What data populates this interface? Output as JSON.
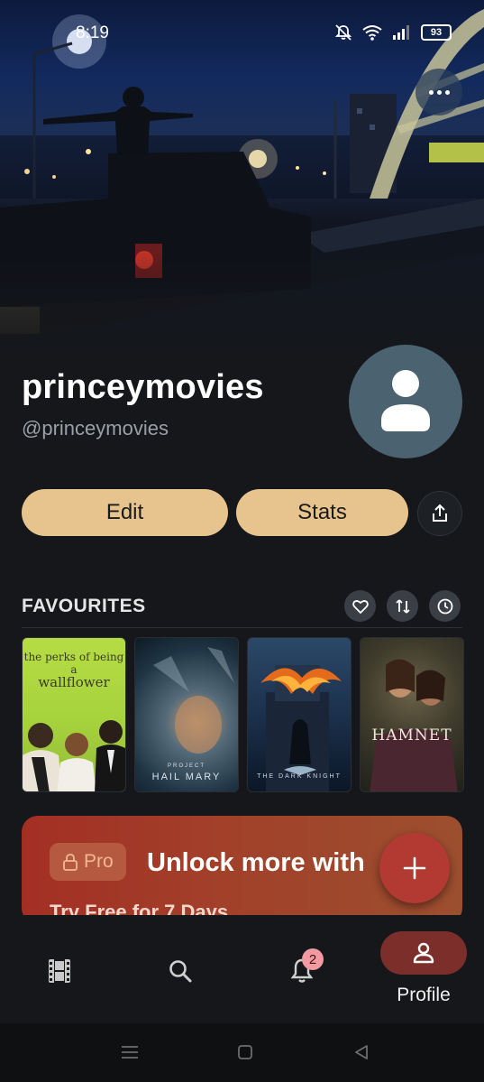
{
  "status_bar": {
    "time": "8:19",
    "battery": "93",
    "icons": [
      "bell-off-icon",
      "wifi-icon",
      "signal-icon",
      "battery-icon"
    ]
  },
  "header": {
    "more_icon": "more-horizontal-icon"
  },
  "profile": {
    "display_name": "princeymovies",
    "handle": "@princeymovies",
    "avatar_icon": "person-icon"
  },
  "actions": {
    "edit_label": "Edit",
    "stats_label": "Stats",
    "share_icon": "share-icon"
  },
  "favourites": {
    "title": "FAVOURITES",
    "filter_icons": [
      "heart-icon",
      "swap-icon",
      "clock-icon"
    ],
    "posters": [
      {
        "title_line1": "the perks of being a",
        "title_line2": "wallflower"
      },
      {
        "title_line1": "PROJECT",
        "title_line2": "HAIL MARY"
      },
      {
        "title_line1": "THE DARK KNIGHT"
      },
      {
        "title_line1": "HAMNET"
      }
    ]
  },
  "pro_banner": {
    "badge_label": "Pro",
    "title": "Unlock more with",
    "subtitle": "Try Free for 7 Days"
  },
  "fab": {
    "icon": "plus-icon"
  },
  "bottom_nav": {
    "items": [
      {
        "icon": "film-icon"
      },
      {
        "icon": "search-icon"
      },
      {
        "icon": "bell-icon",
        "badge": "2"
      },
      {
        "icon": "person-icon",
        "label": "Profile",
        "active": true
      }
    ]
  },
  "system_nav": {
    "icons": [
      "menu-icon",
      "home-icon",
      "back-icon"
    ]
  },
  "colors": {
    "background": "#15171a",
    "accent_button": "#e7c48d",
    "pro_banner": "#a32f23",
    "fab": "#b23a33",
    "active_nav": "#7c2f2a",
    "avatar_bg": "#4b6271"
  }
}
